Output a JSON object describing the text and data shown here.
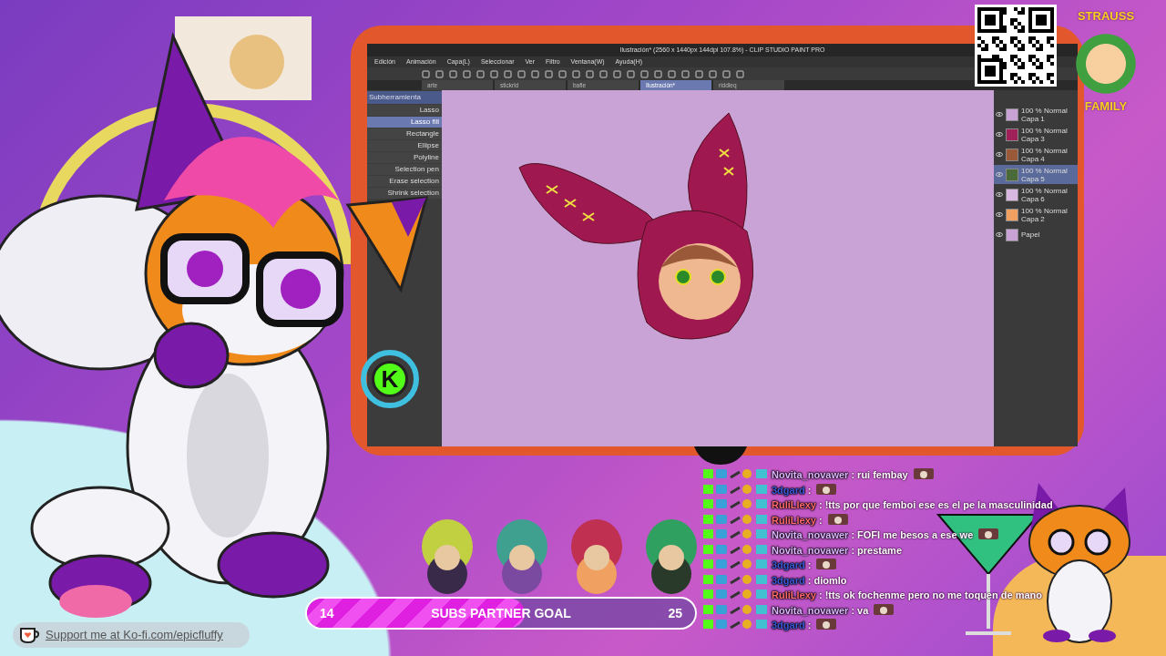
{
  "app_window": {
    "title": "Ilustración* (2560 x 1440px 144dpi 107.8%) - CLIP STUDIO PAINT PRO",
    "menu": [
      "Edición",
      "Animación",
      "Capa(L)",
      "Seleccionar",
      "Ver",
      "Filtro",
      "Ventana(W)",
      "Ayuda(H)"
    ],
    "document_tabs": [
      {
        "label": "arte",
        "selected": false
      },
      {
        "label": "stickrld",
        "selected": false
      },
      {
        "label": "bafle",
        "selected": false
      },
      {
        "label": "Ilustración*",
        "selected": true
      },
      {
        "label": "riddleq",
        "selected": false
      }
    ],
    "tool_panel": {
      "header": "Subherramienta",
      "items": [
        {
          "label": "Lasso",
          "selected": false
        },
        {
          "label": "Lasso fill",
          "selected": true
        },
        {
          "label": "Rectangle",
          "selected": false
        },
        {
          "label": "Ellipse",
          "selected": false
        },
        {
          "label": "Polyline",
          "selected": false
        },
        {
          "label": "Selection pen",
          "selected": false
        },
        {
          "label": "Erase selection",
          "selected": false
        },
        {
          "label": "Shrink selection",
          "selected": false
        }
      ]
    },
    "layers": [
      {
        "blend": "100 % Normal",
        "name": "Capa 1",
        "color": "#c9a3d6",
        "selected": false
      },
      {
        "blend": "100 % Normal",
        "name": "Capa 3",
        "color": "#a0205a",
        "selected": false
      },
      {
        "blend": "100 % Normal",
        "name": "Capa 4",
        "color": "#9a5a3a",
        "selected": false
      },
      {
        "blend": "100 % Normal",
        "name": "Capa 5",
        "color": "#4a6a3a",
        "selected": true
      },
      {
        "blend": "100 % Normal",
        "name": "Capa 6",
        "color": "#d8b8e0",
        "selected": false
      },
      {
        "blend": "100 % Normal",
        "name": "Capa 2",
        "color": "#f0a060",
        "selected": false
      },
      {
        "name": "Papel",
        "color": "#c9a3d6",
        "selected": false
      }
    ]
  },
  "kick_logo": {
    "letter": "K"
  },
  "logo_badge": {
    "top": "STRAUSS",
    "bottom": "FAMILY"
  },
  "chat": [
    {
      "username": "Novita_novawer",
      "color": "#dcb8ff",
      "text": ": rui fembay",
      "emote": true
    },
    {
      "username": "3dgard",
      "color": "#3a5ad8",
      "text": ":",
      "emote": true
    },
    {
      "username": "RuliLlexy",
      "color": "#ff6a6a",
      "text": ": !tts por que femboi ese es el pe la masculinidad",
      "emote": false
    },
    {
      "username": "RuliLlexy",
      "color": "#ff6a6a",
      "text": ":",
      "emote": true
    },
    {
      "username": "Novita_novawer",
      "color": "#dcb8ff",
      "text": ": FOFI me besos a ese we",
      "emote": true
    },
    {
      "username": "Novita_novawer",
      "color": "#dcb8ff",
      "text": ": prestame",
      "emote": false
    },
    {
      "username": "3dgard",
      "color": "#3a5ad8",
      "text": ":",
      "emote": true
    },
    {
      "username": "3dgard",
      "color": "#3a5ad8",
      "text": ": diomlo",
      "emote": false
    },
    {
      "username": "RuliLlexy",
      "color": "#ff6a6a",
      "text": ": !tts ok fochenme pero no me toquen de mano",
      "emote": false
    },
    {
      "username": "Novita_novawer",
      "color": "#dcb8ff",
      "text": ": va",
      "emote": true
    },
    {
      "username": "3dgard",
      "color": "#3a5ad8",
      "text": ":",
      "emote": true
    }
  ],
  "goal": {
    "current": "14",
    "label": "SUBS PARTNER GOAL",
    "target": "25",
    "level": 0.56
  },
  "support_link": {
    "text": "Support me at Ko-fi.com/epicfluffy"
  }
}
